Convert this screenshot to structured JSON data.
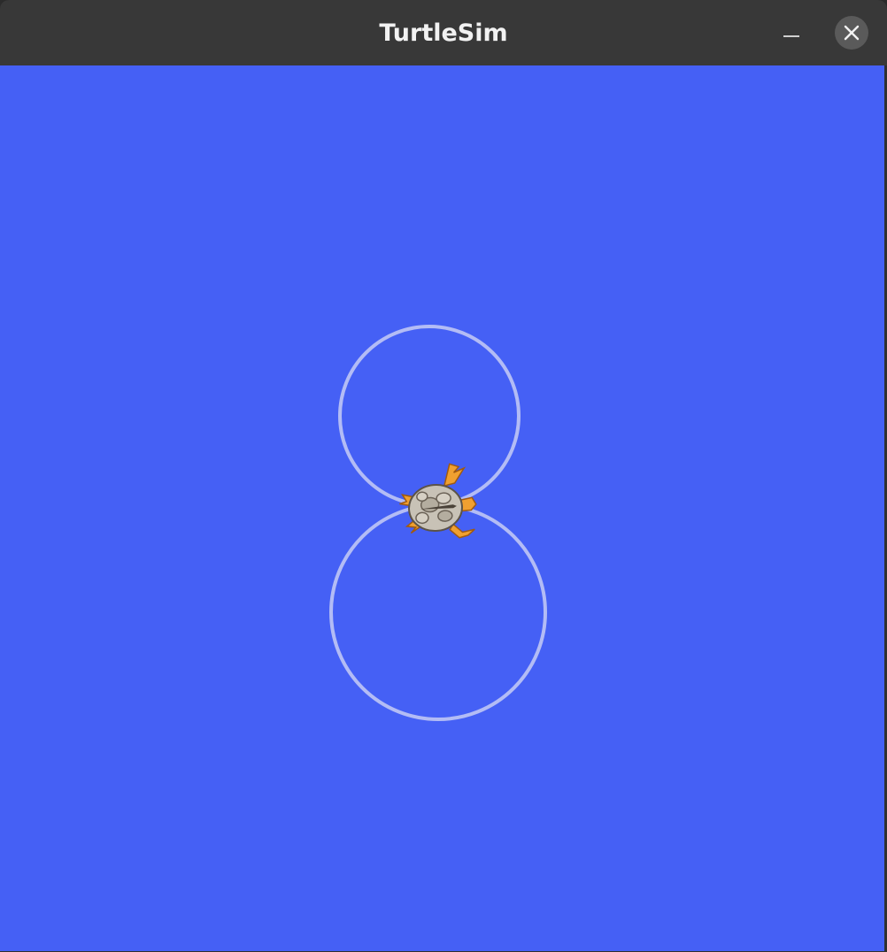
{
  "window": {
    "title": "TurtleSim"
  },
  "colors": {
    "background": "#4560f5",
    "pen": "#b3bcf5",
    "titlebar": "#383838"
  },
  "icons": {
    "minimize": "minimize-icon",
    "close": "close-icon",
    "turtle": "turtle-icon"
  }
}
